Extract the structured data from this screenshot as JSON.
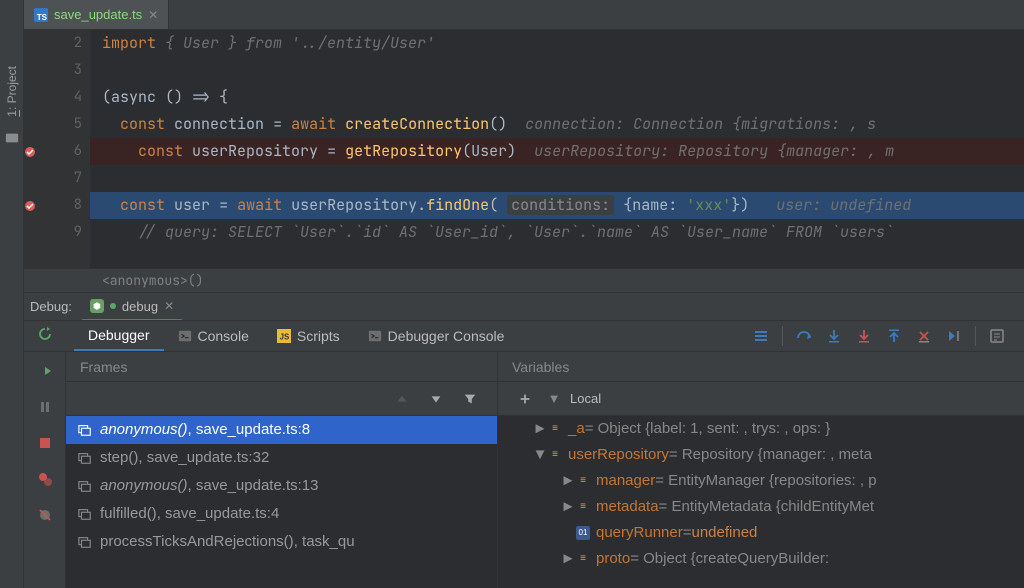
{
  "tab": {
    "filename": "save_update.ts"
  },
  "toolwindow": {
    "project_prefix": "1",
    "project_label": ": Project"
  },
  "lines": [
    {
      "n": 2
    },
    {
      "n": 3
    },
    {
      "n": 4
    },
    {
      "n": 5
    },
    {
      "n": 6,
      "bp": true
    },
    {
      "n": 7
    },
    {
      "n": 8,
      "bp": true
    },
    {
      "n": 9
    }
  ],
  "code": {
    "l2_import": "import",
    "l2_body": "{ User } from '../entity/User'",
    "l4_async": "(async () => {",
    "l5_const": "const",
    "l5_var": "connection",
    "l5_eq": " = ",
    "l5_await": "await",
    "l5_call": "createConnection",
    "l5_args": "()",
    "l5_hint": "connection: Connection {migrations: , s",
    "l6_const": "const",
    "l6_var": "userRepository",
    "l6_eq": " = ",
    "l6_call": "getRepository",
    "l6_args": "(User)",
    "l6_hint": "userRepository: Repository {manager: , m",
    "l8_const": "const",
    "l8_var": "user",
    "l8_eq": " = ",
    "l8_await": "await",
    "l8_rec": "userRepository",
    "l8_fn": "findOne",
    "l8_param_hint": "conditions:",
    "l8_arg": "{name: 'xxx'})",
    "l8_hint": "user: undefined",
    "l9_cmt": "// query: SELECT `User`.`id` AS `User_id`, `User`.`name` AS `User_name` FROM `users`"
  },
  "crumb": "<anonymous>()",
  "debug": {
    "label": "Debug:",
    "config": "debug",
    "tabs": {
      "debugger": "Debugger",
      "console": "Console",
      "scripts": "Scripts",
      "dbg_console": "Debugger Console"
    }
  },
  "frames": {
    "title": "Frames",
    "items": [
      {
        "fn": "anonymous()",
        "loc": "save_update.ts:8",
        "italic": true,
        "sel": true
      },
      {
        "fn": "step()",
        "loc": "save_update.ts:32"
      },
      {
        "fn": "anonymous()",
        "loc": "save_update.ts:13",
        "italic": true
      },
      {
        "fn": "fulfilled()",
        "loc": "save_update.ts:4"
      },
      {
        "fn": "processTicksAndRejections()",
        "loc": "task_qu"
      }
    ]
  },
  "vars": {
    "title": "Variables",
    "local": "Local",
    "rows": [
      {
        "indent": 1,
        "exp": "►",
        "ic": "obj",
        "key": "_a",
        "val": " = Object {label: 1, sent: , trys: , ops: }"
      },
      {
        "indent": 1,
        "exp": "▼",
        "ic": "obj",
        "key": "userRepository",
        "val": " = Repository {manager: , meta"
      },
      {
        "indent": 2,
        "exp": "►",
        "ic": "obj",
        "key": "manager",
        "val": " = EntityManager {repositories: , p"
      },
      {
        "indent": 2,
        "exp": "►",
        "ic": "obj",
        "key": "metadata",
        "val": " = EntityMetadata {childEntityMet"
      },
      {
        "indent": 2,
        "exp": "",
        "ic": "prim",
        "key": "queryRunner",
        "val": " = ",
        "und": "undefined"
      },
      {
        "indent": 2,
        "exp": "►",
        "ic": "obj",
        "key": "proto",
        "val": " = Object {createQueryBuilder: "
      }
    ]
  }
}
